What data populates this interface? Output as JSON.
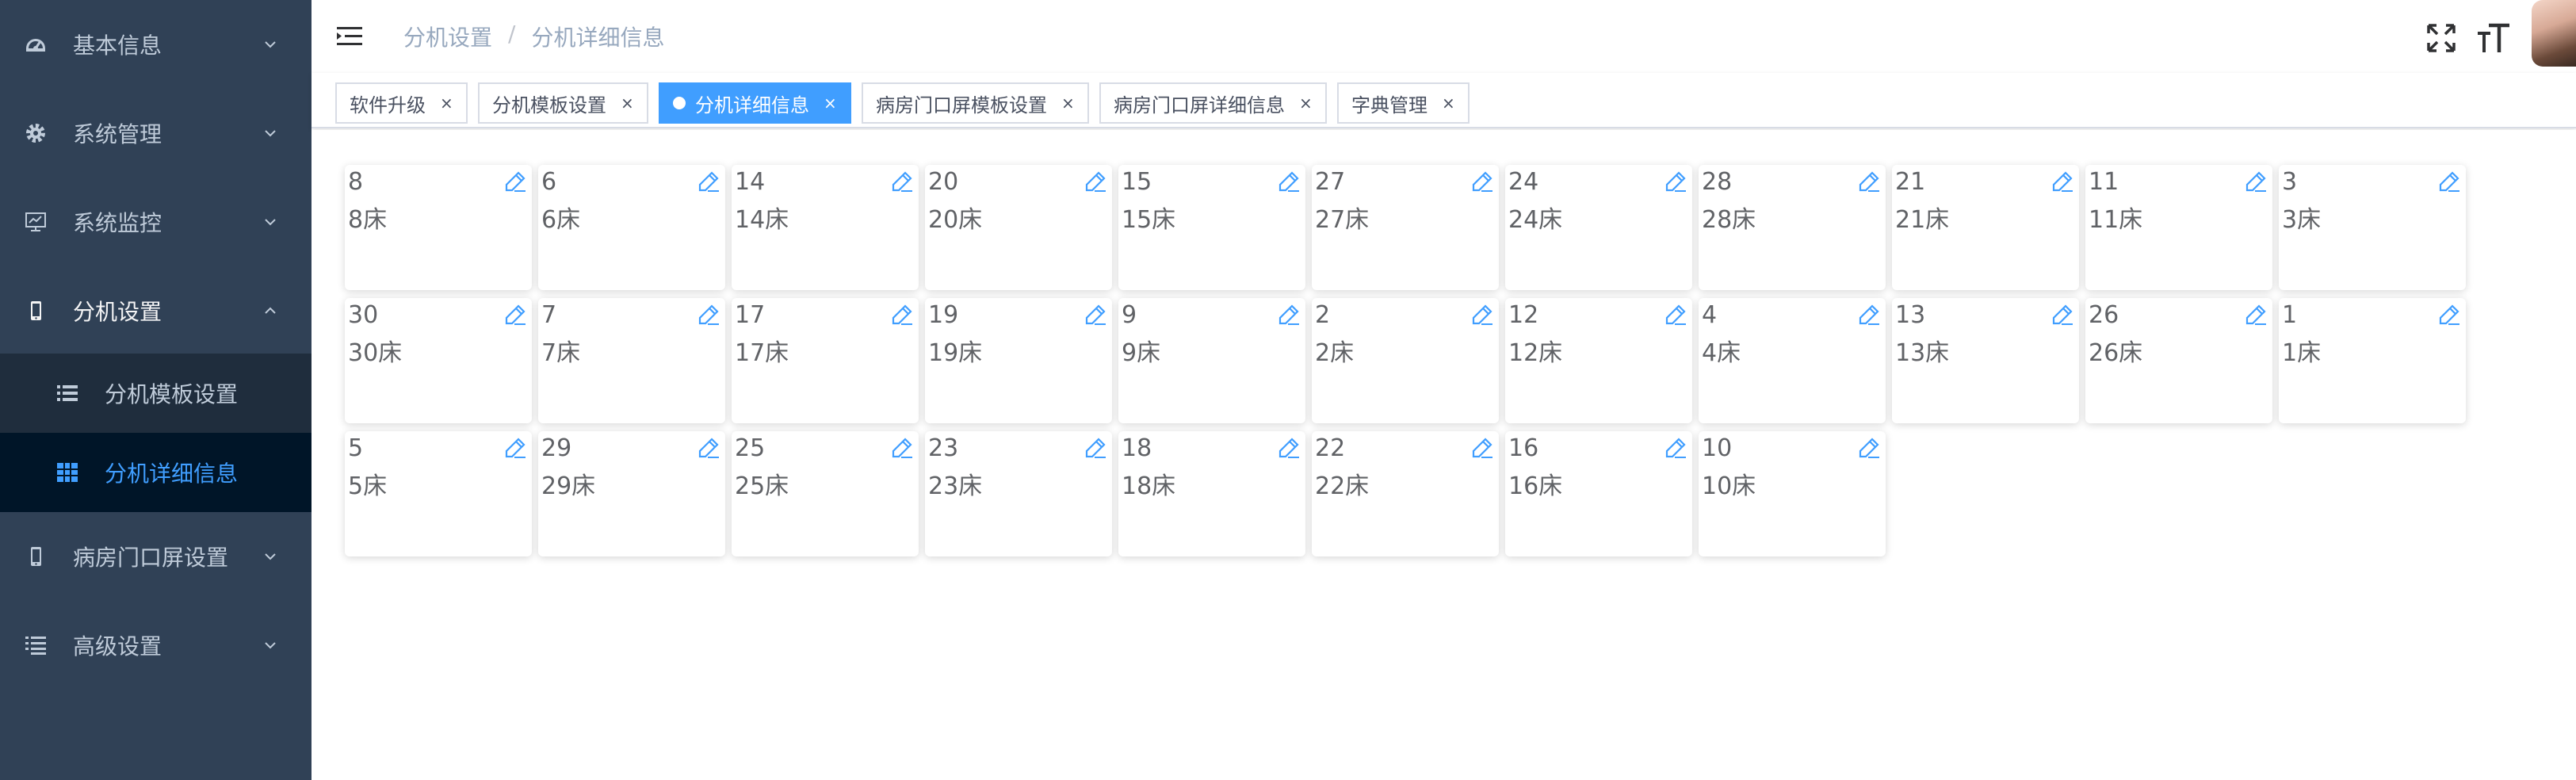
{
  "sidebar": {
    "items": [
      {
        "label": "基本信息",
        "icon": "dashboard-icon"
      },
      {
        "label": "系统管理",
        "icon": "gear-icon"
      },
      {
        "label": "系统监控",
        "icon": "monitor-icon"
      },
      {
        "label": "分机设置",
        "icon": "phone-icon",
        "expanded": true,
        "children": [
          {
            "label": "分机模板设置",
            "icon": "list-icon"
          },
          {
            "label": "分机详细信息",
            "icon": "grid-icon",
            "active": true
          }
        ]
      },
      {
        "label": "病房门口屏设置",
        "icon": "phone-icon"
      },
      {
        "label": "高级设置",
        "icon": "list-icon"
      }
    ]
  },
  "breadcrumb": [
    "分机设置",
    "分机详细信息"
  ],
  "tags": [
    {
      "label": "软件升级"
    },
    {
      "label": "分机模板设置"
    },
    {
      "label": "分机详细信息",
      "active": true
    },
    {
      "label": "病房门口屏模板设置"
    },
    {
      "label": "病房门口屏详细信息"
    },
    {
      "label": "字典管理"
    }
  ],
  "tag_close": "×",
  "colors": {
    "sidebar_bg": "#304156",
    "active_blue": "#409eff",
    "submenu_bg": "#1f2d3d"
  },
  "cards": [
    {
      "num": "8",
      "bed": "8床"
    },
    {
      "num": "6",
      "bed": "6床"
    },
    {
      "num": "14",
      "bed": "14床"
    },
    {
      "num": "20",
      "bed": "20床"
    },
    {
      "num": "15",
      "bed": "15床"
    },
    {
      "num": "27",
      "bed": "27床"
    },
    {
      "num": "24",
      "bed": "24床"
    },
    {
      "num": "28",
      "bed": "28床"
    },
    {
      "num": "21",
      "bed": "21床"
    },
    {
      "num": "11",
      "bed": "11床"
    },
    {
      "num": "3",
      "bed": "3床"
    },
    {
      "num": "30",
      "bed": "30床"
    },
    {
      "num": "7",
      "bed": "7床"
    },
    {
      "num": "17",
      "bed": "17床"
    },
    {
      "num": "19",
      "bed": "19床"
    },
    {
      "num": "9",
      "bed": "9床"
    },
    {
      "num": "2",
      "bed": "2床"
    },
    {
      "num": "12",
      "bed": "12床"
    },
    {
      "num": "4",
      "bed": "4床"
    },
    {
      "num": "13",
      "bed": "13床"
    },
    {
      "num": "26",
      "bed": "26床"
    },
    {
      "num": "1",
      "bed": "1床"
    },
    {
      "num": "5",
      "bed": "5床"
    },
    {
      "num": "29",
      "bed": "29床"
    },
    {
      "num": "25",
      "bed": "25床"
    },
    {
      "num": "23",
      "bed": "23床"
    },
    {
      "num": "18",
      "bed": "18床"
    },
    {
      "num": "22",
      "bed": "22床"
    },
    {
      "num": "16",
      "bed": "16床"
    },
    {
      "num": "10",
      "bed": "10床"
    }
  ]
}
